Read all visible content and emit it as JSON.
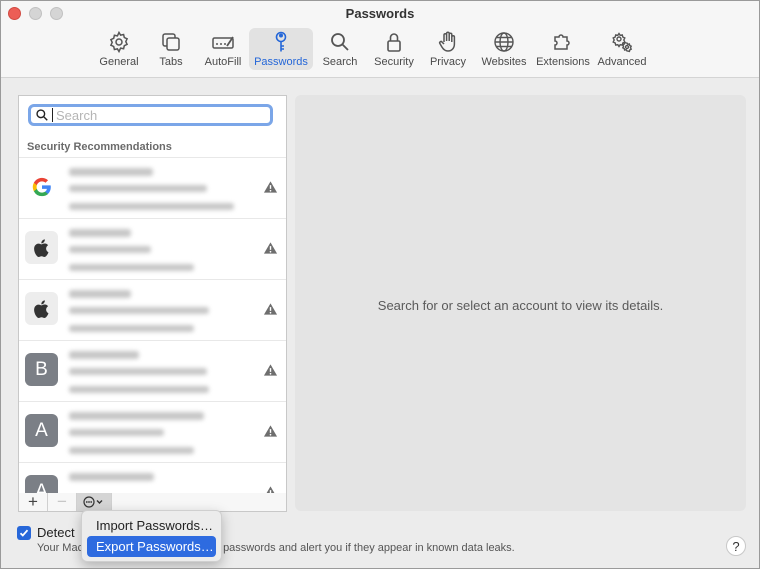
{
  "window": {
    "title": "Passwords"
  },
  "tabs": [
    {
      "label": "General",
      "icon": "gear-icon"
    },
    {
      "label": "Tabs",
      "icon": "tabs-icon"
    },
    {
      "label": "AutoFill",
      "icon": "autofill-icon"
    },
    {
      "label": "Passwords",
      "icon": "key-icon"
    },
    {
      "label": "Search",
      "icon": "search-icon"
    },
    {
      "label": "Security",
      "icon": "lock-icon"
    },
    {
      "label": "Privacy",
      "icon": "hand-icon"
    },
    {
      "label": "Websites",
      "icon": "globe-icon"
    },
    {
      "label": "Extensions",
      "icon": "puzzle-icon"
    },
    {
      "label": "Advanced",
      "icon": "gears-icon"
    }
  ],
  "active_tab": "Passwords",
  "search": {
    "placeholder": "Search",
    "value": ""
  },
  "list": {
    "section_header": "Security Recommendations",
    "items": [
      {
        "avatar": "google-logo",
        "letter": "",
        "warning": true
      },
      {
        "avatar": "apple-logo",
        "letter": "",
        "warning": true
      },
      {
        "avatar": "apple-logo",
        "letter": "",
        "warning": true
      },
      {
        "avatar": "letter",
        "letter": "B",
        "warning": true
      },
      {
        "avatar": "letter",
        "letter": "A",
        "warning": true
      },
      {
        "avatar": "letter",
        "letter": "A",
        "warning": true
      }
    ]
  },
  "bottom_bar": {
    "add": "+",
    "remove": "−"
  },
  "detail": {
    "placeholder_text": "Search for or select an account to view its details."
  },
  "menu": {
    "items": [
      {
        "label": "Import Passwords…"
      },
      {
        "label": "Export Passwords…"
      }
    ]
  },
  "detect": {
    "label_visible": "Detect",
    "checked": true,
    "description_prefix": "Your Mac",
    "description_suffix": "passwords and alert you if they appear in known data leaks."
  },
  "help": {
    "label": "?"
  },
  "colors": {
    "accent": "#2767d9",
    "close": "#ec5e56",
    "avatar_gray": "#7b7f86"
  }
}
